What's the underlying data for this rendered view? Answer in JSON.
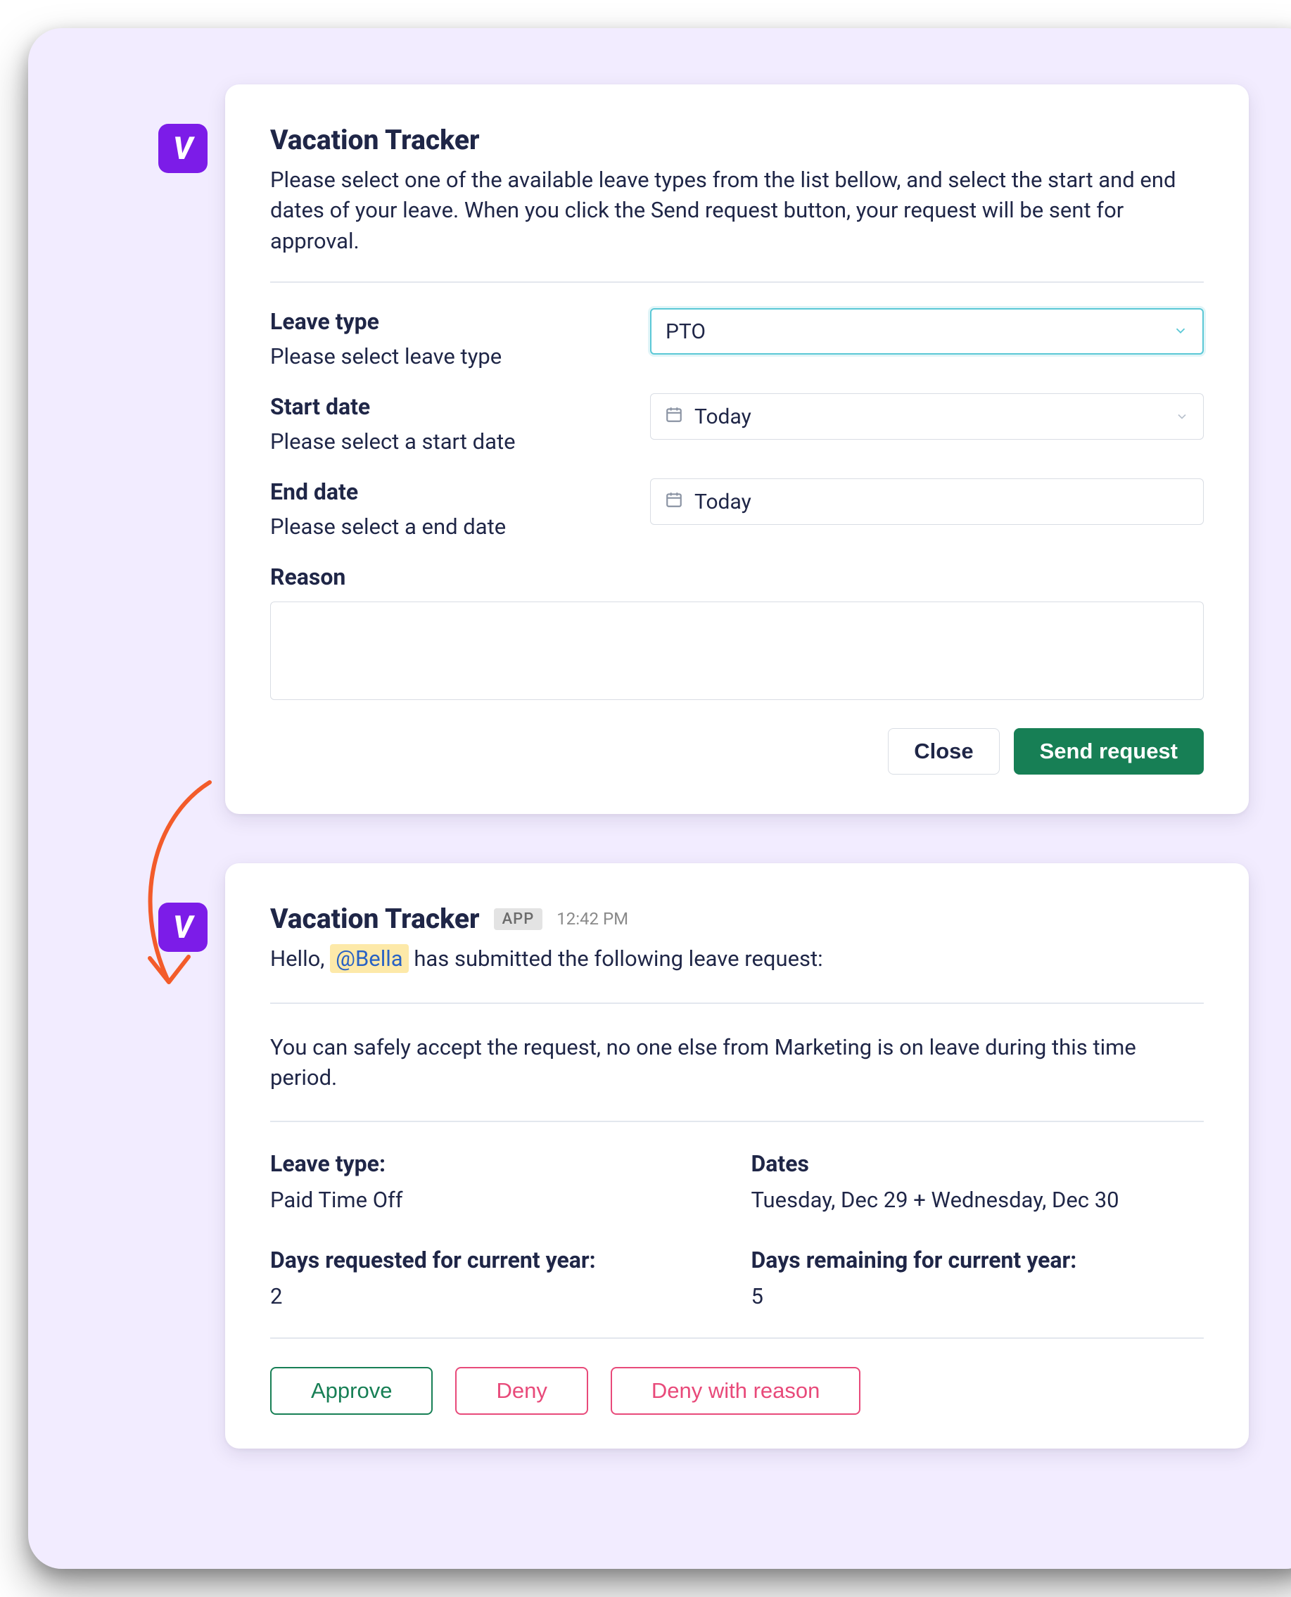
{
  "form_card": {
    "title": "Vacation Tracker",
    "intro": "Please select one of the available leave types from the list bellow, and select the start and end dates of your leave. When you click the Send request button, your request will be sent for approval.",
    "leave_type": {
      "label": "Leave type",
      "help": "Please select leave type",
      "value": "PTO"
    },
    "start_date": {
      "label": "Start date",
      "help": "Please select a start date",
      "value": "Today"
    },
    "end_date": {
      "label": "End date",
      "help": "Please select a end date",
      "value": "Today"
    },
    "reason": {
      "label": "Reason",
      "value": ""
    },
    "actions": {
      "close": "Close",
      "send": "Send request"
    }
  },
  "message_card": {
    "title": "Vacation Tracker",
    "badge": "APP",
    "timestamp": "12:42 PM",
    "greeting_prefix": "Hello, ",
    "mention": "@Bella",
    "greeting_suffix": " has submitted the following leave request:",
    "note": "You can safely accept the request, no one else from Marketing is on leave during this time period.",
    "fields": {
      "leave_type": {
        "label": "Leave type:",
        "value": "Paid Time Off"
      },
      "dates": {
        "label": "Dates",
        "value": "Tuesday, Dec 29 + Wednesday, Dec 30"
      },
      "days_req": {
        "label": "Days requested for current year:",
        "value": "2"
      },
      "days_remain": {
        "label": "Days remaining for current year:",
        "value": "5"
      }
    },
    "actions": {
      "approve": "Approve",
      "deny": "Deny",
      "deny_reason": "Deny with reason"
    }
  },
  "icons": {
    "logo_letter": "V"
  },
  "colors": {
    "accent": "#7C1CE8",
    "primary_green": "#177F55",
    "pink": "#E84A7A",
    "teal": "#5bc8d6",
    "arrow": "#F35B2A"
  }
}
